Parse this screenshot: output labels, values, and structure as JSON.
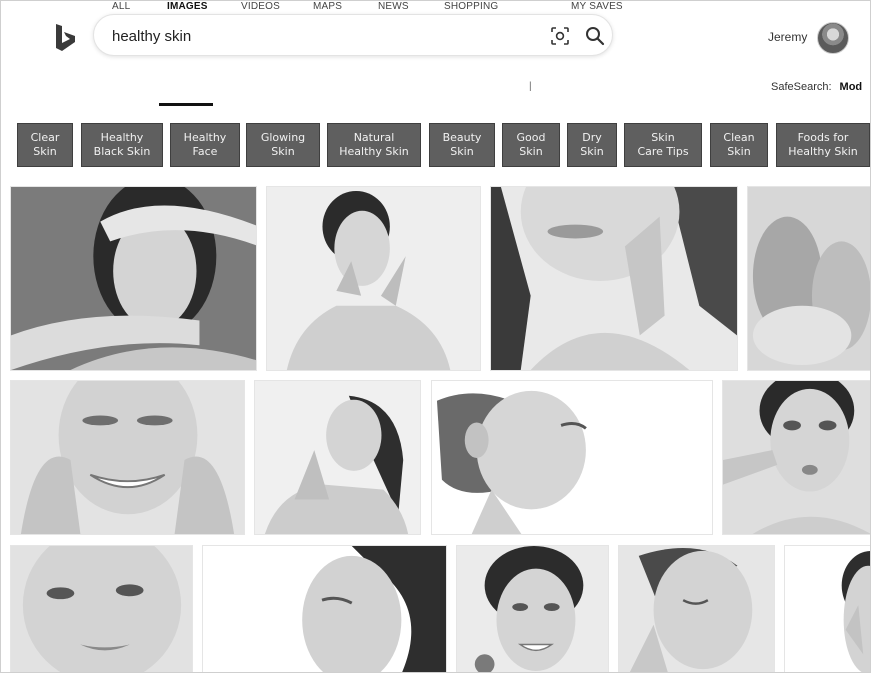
{
  "search": {
    "query": "healthy skin",
    "placeholder": ""
  },
  "user": {
    "name": "Jeremy"
  },
  "nav": {
    "tabs": [
      {
        "label": "ALL",
        "active": false
      },
      {
        "label": "IMAGES",
        "active": true
      },
      {
        "label": "VIDEOS",
        "active": false
      },
      {
        "label": "MAPS",
        "active": false
      },
      {
        "label": "NEWS",
        "active": false
      },
      {
        "label": "SHOPPING",
        "active": false
      },
      {
        "label": "MY SAVES",
        "active": false
      }
    ],
    "separator": "|",
    "safesearch_label": "SafeSearch:",
    "safesearch_value": "Mod"
  },
  "chips": [
    "Clear\nSkin",
    "Healthy\nBlack Skin",
    "Healthy\nFace",
    "Glowing\nSkin",
    "Natural\nHealthy Skin",
    "Beauty\nSkin",
    "Good\nSkin",
    "Dry\nSkin",
    "Skin\nCare Tips",
    "Clean\nSkin",
    "Foods for\nHealthy Skin"
  ],
  "colors": {
    "chip_bg": "#5f5f5f",
    "chip_text": "#f1f1f1",
    "logo": "#3a3a3a"
  }
}
